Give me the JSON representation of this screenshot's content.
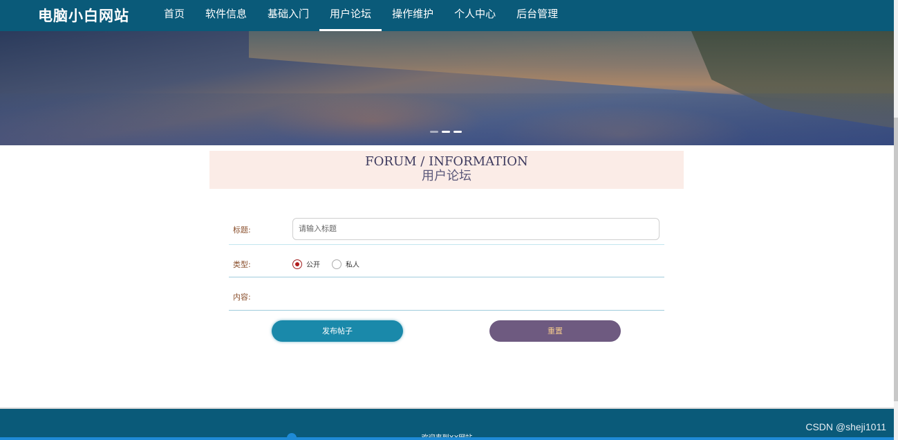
{
  "site": {
    "title": "电脑小白网站"
  },
  "nav": {
    "items": [
      {
        "label": "首页",
        "active": false
      },
      {
        "label": "软件信息",
        "active": false
      },
      {
        "label": "基础入门",
        "active": false
      },
      {
        "label": "用户论坛",
        "active": true
      },
      {
        "label": "操作维护",
        "active": false
      },
      {
        "label": "个人中心",
        "active": false
      },
      {
        "label": "后台管理",
        "active": false
      }
    ]
  },
  "section": {
    "title_en": "FORUM / INFORMATION",
    "title_cn": "用户论坛"
  },
  "form": {
    "title_label": "标题:",
    "title_placeholder": "请输入标题",
    "type_label": "类型:",
    "type_options": [
      {
        "label": "公开",
        "checked": true
      },
      {
        "label": "私人",
        "checked": false
      }
    ],
    "content_label": "内容:",
    "submit_label": "发布帖子",
    "reset_label": "重置"
  },
  "footer": {
    "text": "欢迎来到XX网站"
  },
  "watermark": "CSDN @sheji1011",
  "colors": {
    "nav_bg": "#0a5a79",
    "submit_bg": "#1a89aa",
    "reset_bg": "#6e5a80",
    "section_bg": "#fbece7"
  }
}
